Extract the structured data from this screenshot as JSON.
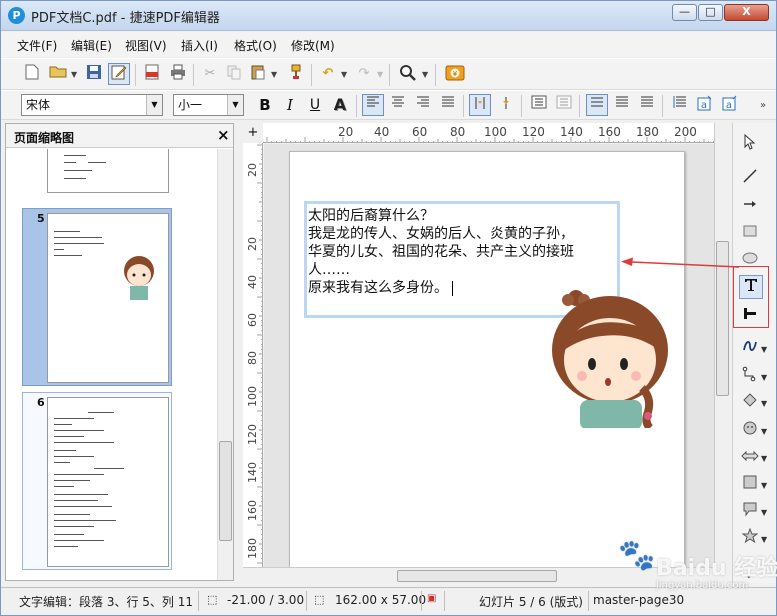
{
  "window": {
    "logo": "P",
    "title": "PDF文档C.pdf - 捷速PDF编辑器",
    "min": "—",
    "max": "□",
    "close": "X"
  },
  "menu": [
    "文件(F)",
    "编辑(E)",
    "视图(V)",
    "插入(I)",
    "格式(O)",
    "修改(M)"
  ],
  "format_bar": {
    "font": "宋体",
    "size": "小一",
    "bold": "B",
    "italic": "I",
    "underline": "U",
    "shadow": "A"
  },
  "thumbnails": {
    "title": "页面缩略图",
    "close": "×",
    "pages": [
      {
        "num": "5",
        "selected": true
      },
      {
        "num": "6",
        "selected": false
      }
    ]
  },
  "rulers": {
    "corner": "+",
    "h_labels": [
      "20",
      "40",
      "60",
      "80",
      "100",
      "120",
      "140",
      "160",
      "180",
      "200"
    ],
    "v_labels": [
      "20",
      "20",
      "40",
      "60",
      "80",
      "100",
      "120",
      "140",
      "160",
      "180"
    ]
  },
  "document": {
    "lines": [
      "太阳的后裔算什么？",
      "我是龙的传人、女娲的后人、炎黄的子孙，",
      "华夏的儿女、祖国的花朵、共产主义的接班",
      "人……",
      "原来我有这么多身份。"
    ]
  },
  "status": {
    "mode": "文字编辑：段落 3、行 5、列 11",
    "position": "-21.00 / 3.00",
    "size": "162.00 x 57.00",
    "slide": "幻灯片 5 / 6 (版式)",
    "master": "master-page30"
  },
  "watermark": {
    "text": "Baidu 经验",
    "sub": "jingyan.baidu.com"
  },
  "colors": {
    "frame_border": "#bcd7f4",
    "annotation_red": "#e03a3a",
    "selected_thumb": "#a8c4e6"
  }
}
